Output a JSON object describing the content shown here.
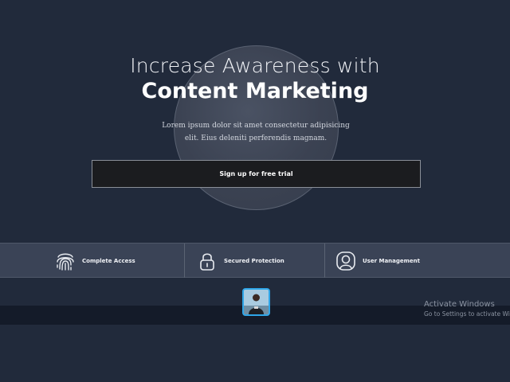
{
  "hero": {
    "title_light": "Increase Awareness with",
    "title_bold": "Content Marketing",
    "description": "Lorem ipsum dolor sit amet consectetur adipisicing elit. Eius deleniti perferendis magnam.",
    "cta_label": "Sign up for free trial"
  },
  "features": [
    {
      "icon": "fingerprint-icon",
      "label": "Complete Access"
    },
    {
      "icon": "lock-icon",
      "label": "Secured Protection"
    },
    {
      "icon": "user-badge-icon",
      "label": "User Management"
    }
  ],
  "taskbar": {
    "app_icon": "person-photo-icon"
  },
  "watermark": {
    "title": "Activate Windows",
    "subtitle": "Go to Settings to activate Windows."
  },
  "colors": {
    "background": "#212a3b",
    "feature_bar": "#3a4356",
    "button_bg": "#1b1c1f",
    "taskbar": "#141b29",
    "taskbar_app_border": "#2fa6e8"
  }
}
